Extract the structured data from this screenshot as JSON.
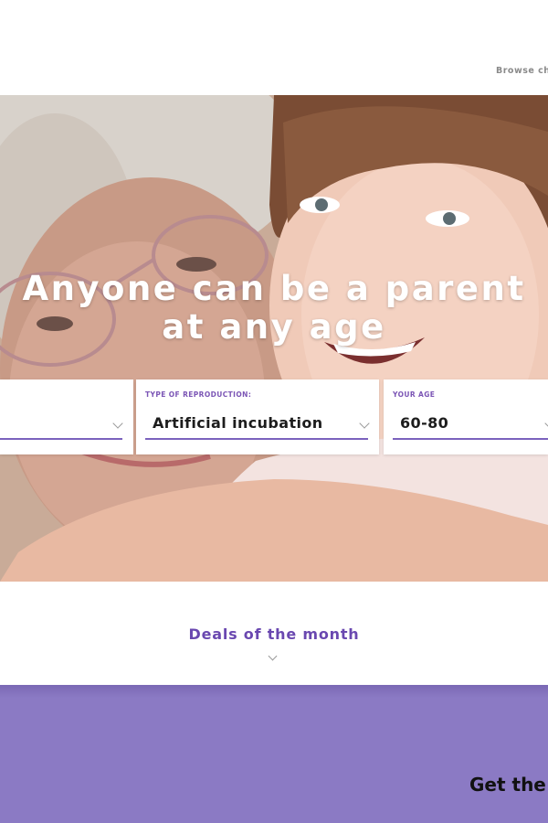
{
  "header": {
    "nav_link": "Browse ch"
  },
  "hero": {
    "headline_line1": "Anyone can be a parent",
    "headline_line2": "at any age",
    "image_description": "grandmother-and-child-photo"
  },
  "filters": [
    {
      "label": "",
      "value": ""
    },
    {
      "label": "TYPE OF REPRODUCTION:",
      "value": "Artificial incubation"
    },
    {
      "label": "YOUR AGE",
      "value": "60-80"
    }
  ],
  "deals": {
    "title": "Deals of the month"
  },
  "promo": {
    "text": "Get the"
  },
  "colors": {
    "accent": "#7b55b5",
    "purple_band": "#8b7ac4"
  }
}
